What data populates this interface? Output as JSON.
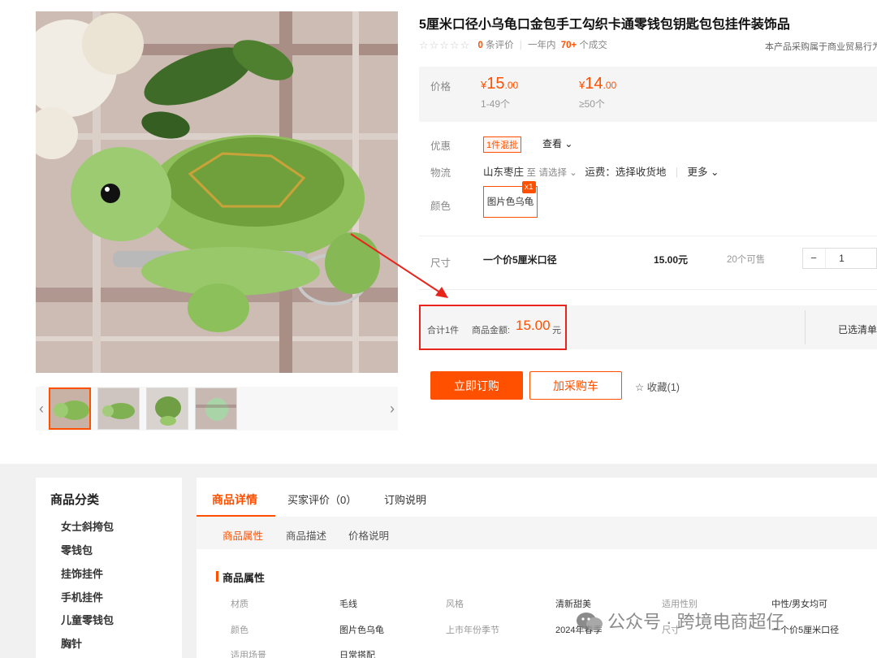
{
  "gallery": {
    "prev_arrow": "‹",
    "next_arrow": "›",
    "thumbnail_count": 4,
    "active_thumbnail": 1
  },
  "product": {
    "title": "5厘米口径小乌龟口金包手工勾织卡通零钱包钥匙包包挂件装饰品",
    "rating": {
      "reviews_count": "0",
      "reviews_suffix": "条评价",
      "sales_prefix": "一年内",
      "sales_count": "70+",
      "sales_suffix": "个成交",
      "trade_notice": "本产品采购属于商业贸易行为"
    }
  },
  "price": {
    "label": "价格",
    "tiers": [
      {
        "currency": "¥",
        "integer": "15",
        "decimal": ".00",
        "range": "1-49个"
      },
      {
        "currency": "¥",
        "integer": "14",
        "decimal": ".00",
        "range": "≥50个"
      }
    ]
  },
  "promotion": {
    "label": "优惠",
    "tag": "1件混批",
    "view": "查看 ⌄"
  },
  "logistics": {
    "label": "物流",
    "origin": "山东枣庄",
    "to": "至",
    "destination": "请选择 ⌄",
    "shipping": "运费：选择收货地",
    "more": "更多 ⌄"
  },
  "color": {
    "label": "颜色",
    "option": "图片色乌龟",
    "badge": "x1"
  },
  "size": {
    "label": "尺寸",
    "name": "一个价5厘米口径",
    "price": "15.00元",
    "stock": "20个可售",
    "minus": "−",
    "quantity": "1"
  },
  "total": {
    "count": "合计1件",
    "amount_label": "商品金额:",
    "amount": "15.00",
    "unit": "元",
    "selected_list": "已选清单"
  },
  "actions": {
    "order": "立即订购",
    "cart": "加采购车",
    "favorite": "☆ 收藏(1)"
  },
  "categories": {
    "title": "商品分类",
    "items": [
      "女士斜挎包",
      "零钱包",
      "挂饰挂件",
      "手机挂件",
      "儿童零钱包",
      "胸针"
    ]
  },
  "details": {
    "tabs": [
      "商品详情",
      "买家评价（0）",
      "订购说明"
    ],
    "subtabs": [
      "商品属性",
      "商品描述",
      "价格说明"
    ],
    "attr_heading": "商品属性",
    "attributes": [
      {
        "label": "材质",
        "value": "毛线"
      },
      {
        "label": "风格",
        "value": "清新甜美"
      },
      {
        "label": "适用性别",
        "value": "中性/男女均可"
      },
      {
        "label": "颜色",
        "value": "图片色乌龟"
      },
      {
        "label": "上市年份季节",
        "value": "2024年春季"
      },
      {
        "label": "尺寸",
        "value": "一个价5厘米口径"
      },
      {
        "label": "适用场景",
        "value": "日常搭配"
      }
    ]
  },
  "watermark": {
    "text": "公众号 · 跨境电商超仔"
  },
  "colors": {
    "accent": "#ff5000",
    "highlight": "#e8251c",
    "panel_bg": "#f5f5f5"
  }
}
